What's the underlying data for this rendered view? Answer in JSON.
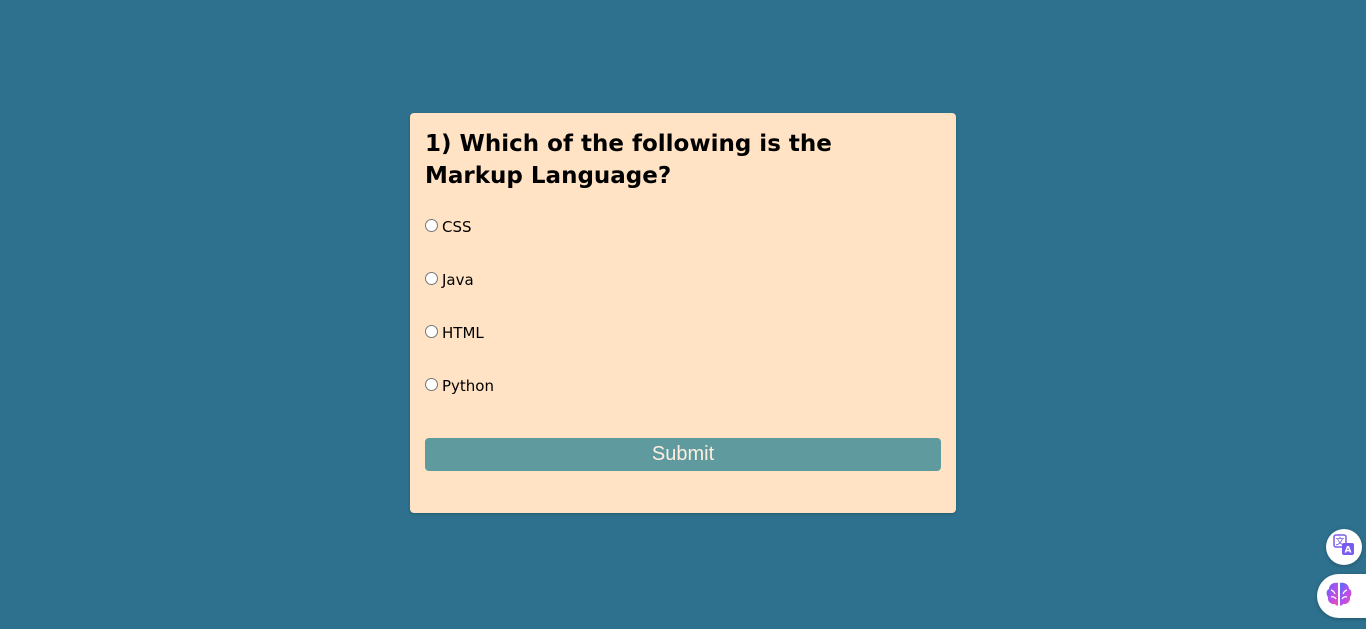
{
  "quiz": {
    "question": "1) Which of the following is the Markup Language?",
    "options": [
      {
        "label": "CSS",
        "selected": false
      },
      {
        "label": "Java",
        "selected": false
      },
      {
        "label": "HTML",
        "selected": false
      },
      {
        "label": "Python",
        "selected": false
      }
    ],
    "submit_label": "Submit"
  },
  "floating_widgets": [
    {
      "icon": "translate-icon"
    },
    {
      "icon": "brain-icon"
    }
  ],
  "colors": {
    "page_background": "#2e718e",
    "card_background": "#ffe3c4",
    "button_background": "#5f9b9e",
    "button_text": "#ffeee0"
  }
}
